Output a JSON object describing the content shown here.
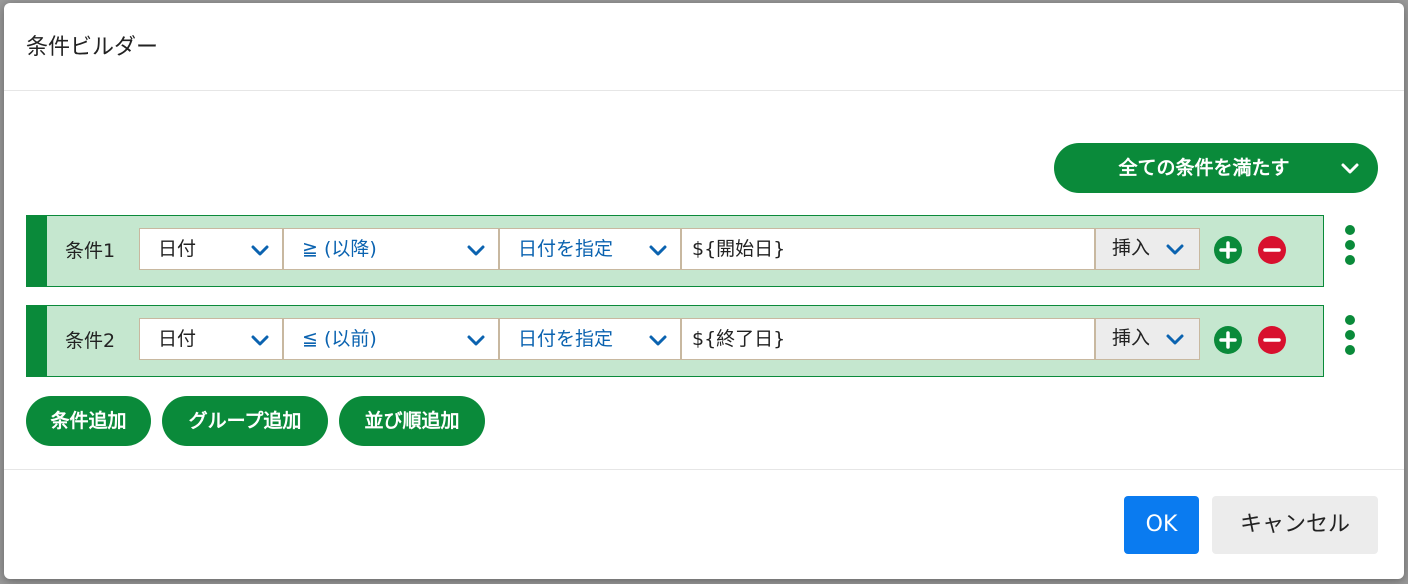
{
  "dialog": {
    "title": "条件ビルダー"
  },
  "match_mode": {
    "label": "全ての条件を満たす",
    "icon": "chevron-down-icon"
  },
  "conditions": [
    {
      "label": "条件1",
      "field": "日付",
      "operator": "≧ (以降)",
      "value_type": "日付を指定",
      "value": "${開始日}",
      "insert_label": "挿入"
    },
    {
      "label": "条件2",
      "field": "日付",
      "operator": "≦ (以前)",
      "value_type": "日付を指定",
      "value": "${終了日}",
      "insert_label": "挿入"
    }
  ],
  "actions": {
    "add_condition": "条件追加",
    "add_group": "グループ追加",
    "add_sort": "並び順追加"
  },
  "footer": {
    "ok": "OK",
    "cancel": "キャンセル"
  },
  "colors": {
    "primary_green": "#0a8a3a",
    "row_background": "#c5e7cf",
    "remove_red": "#d8102e",
    "ok_blue": "#0a7bf0",
    "link_blue": "#0b63b0"
  }
}
